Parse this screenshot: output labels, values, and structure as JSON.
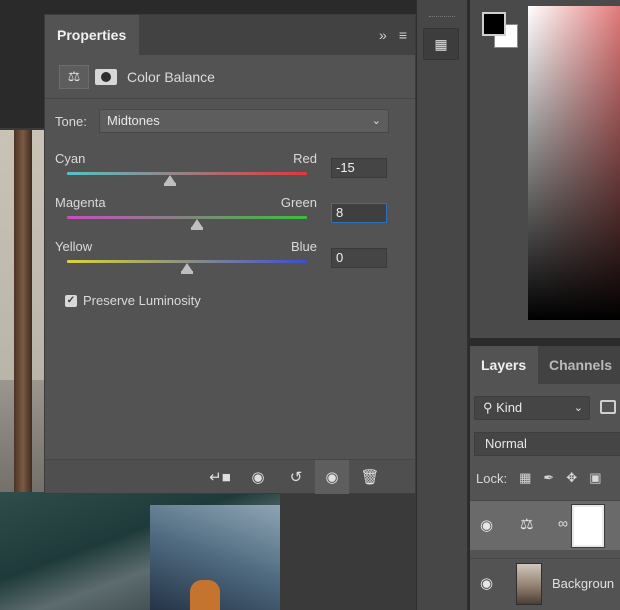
{
  "properties": {
    "tab_label": "Properties",
    "expand_icon": "double-chevron-right-icon",
    "menu_icon": "hamburger-menu-icon",
    "header_title": "Color Balance",
    "tone": {
      "label": "Tone:",
      "value": "Midtones"
    },
    "sliders": [
      {
        "left": "Cyan",
        "right": "Red",
        "value": "-15",
        "fraction": 0.43,
        "gradient": [
          "#56c2c8",
          "#e0383a"
        ]
      },
      {
        "left": "Magenta",
        "right": "Green",
        "value": "8",
        "fraction": 0.54,
        "gradient": [
          "#c64fc0",
          "#3bbd3c"
        ]
      },
      {
        "left": "Yellow",
        "right": "Blue",
        "value": "0",
        "fraction": 0.5,
        "gradient": [
          "#d9d53a",
          "#3e4cd0"
        ]
      }
    ],
    "preserve_luminosity": {
      "label": "Preserve Luminosity",
      "checked": true
    }
  },
  "layers": {
    "tabs": [
      "Layers",
      "Channels"
    ],
    "filter": "Kind",
    "blend_mode": "Normal",
    "lock_label": "Lock:",
    "items": [
      {
        "name": "",
        "type": "adjustment"
      },
      {
        "name": "Backgroun",
        "type": "image"
      }
    ]
  },
  "colors": {
    "foreground": "#000000",
    "background": "#ffffff",
    "panel": "#535353",
    "focus": "#2d6fb8"
  }
}
